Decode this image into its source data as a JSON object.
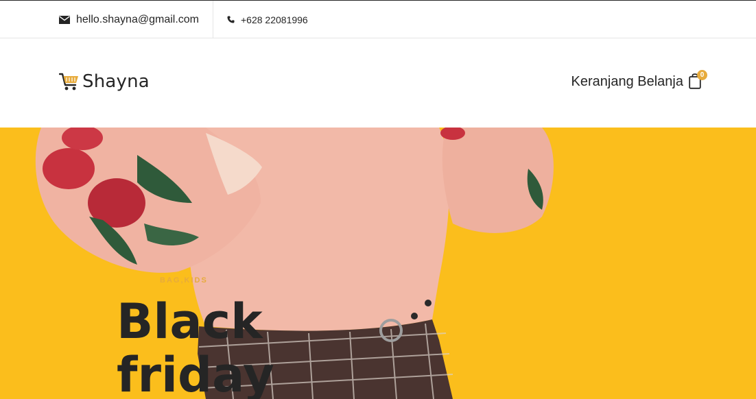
{
  "topbar": {
    "email": "hello.shayna@gmail.com",
    "email_icon": "envelope-icon",
    "phone": "+628 22081996",
    "phone_icon": "phone-icon"
  },
  "header": {
    "logo_icon": "shopping-cart-icon",
    "logo_text": "Shayna",
    "cart_label": "Keranjang Belanja",
    "cart_icon": "shopping-bag-icon",
    "cart_count": "0"
  },
  "hero": {
    "kicker": "Bag,kids",
    "headline_line1": "Black",
    "headline_line2": "friday",
    "background_color": "#fbbe1c"
  },
  "colors": {
    "accent": "#e7ab3c",
    "text": "#252525",
    "hero_bg": "#fbbe1c"
  }
}
